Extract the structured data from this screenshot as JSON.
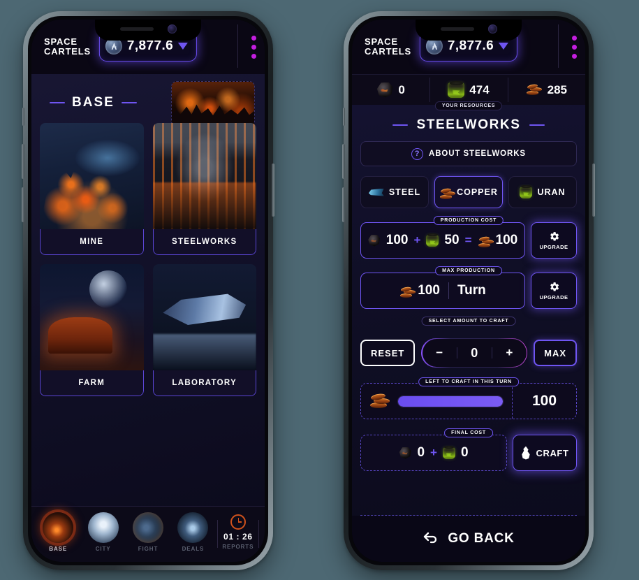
{
  "brand": {
    "line1": "SPACE",
    "line2": "CARTELS"
  },
  "header": {
    "currency_value": "7,877.6",
    "currency_icon": "token-icon",
    "dropdown_icon": "caret-down-icon",
    "menu_icon": "kebab-menu-icon"
  },
  "phone_base": {
    "section_title": "BASE",
    "hero_name": "base-hero-thumbnail",
    "cards": [
      {
        "label": "MINE",
        "art": "mine-artwork"
      },
      {
        "label": "STEELWORKS",
        "art": "steelworks-artwork"
      },
      {
        "label": "FARM",
        "art": "farm-artwork"
      },
      {
        "label": "LABORATORY",
        "art": "laboratory-artwork"
      }
    ],
    "nav": [
      {
        "label": "BASE",
        "active": true
      },
      {
        "label": "CITY",
        "active": false
      },
      {
        "label": "FIGHT",
        "active": false
      },
      {
        "label": "DEALS",
        "active": false
      },
      {
        "label": "REPORTS",
        "active": false
      }
    ],
    "timer": "01 : 26"
  },
  "phone_steelworks": {
    "resources_label": "YOUR RESOURCES",
    "resources": [
      {
        "name": "ore",
        "value": "0"
      },
      {
        "name": "uranium",
        "value": "474"
      },
      {
        "name": "copper",
        "value": "285"
      }
    ],
    "page_title": "STEELWORKS",
    "about_label": "ABOUT STEELWORKS",
    "about_icon": "question-mark-icon",
    "tabs": [
      {
        "label": "STEEL",
        "icon": "steel-ingot-icon",
        "selected": false
      },
      {
        "label": "COPPER",
        "icon": "copper-coins-icon",
        "selected": true
      },
      {
        "label": "URAN",
        "icon": "uranium-barrel-icon",
        "selected": false
      }
    ],
    "production_cost": {
      "tag": "PRODUCTION COST",
      "ore_amount": "100",
      "plus": "+",
      "uranium_amount": "50",
      "equals": "=",
      "output_amount": "100",
      "upgrade_label": "UPGRADE",
      "upgrade_icon": "gear-icon"
    },
    "max_production": {
      "tag": "MAX PRODUCTION",
      "amount": "100",
      "per": "Turn",
      "upgrade_label": "UPGRADE",
      "upgrade_icon": "gear-icon"
    },
    "craft_select": {
      "tag": "SELECT AMOUNT TO CRAFT",
      "reset_label": "RESET",
      "minus": "−",
      "amount": "0",
      "plus": "+",
      "max_label": "MAX"
    },
    "left_to_craft": {
      "tag": "LEFT TO CRAFT IN THIS TURN",
      "value": "100",
      "progress_percent": 100
    },
    "final_cost": {
      "tag": "FINAL COST",
      "ore_amount": "0",
      "plus": "+",
      "uranium_amount": "0",
      "craft_label": "CRAFT",
      "craft_icon": "flame-icon"
    },
    "go_back_label": "GO BACK",
    "go_back_icon": "back-arrow-icon"
  },
  "colors": {
    "accent_purple": "#6f55f2",
    "magenta": "#c41ee0",
    "background": "#4d6873"
  }
}
